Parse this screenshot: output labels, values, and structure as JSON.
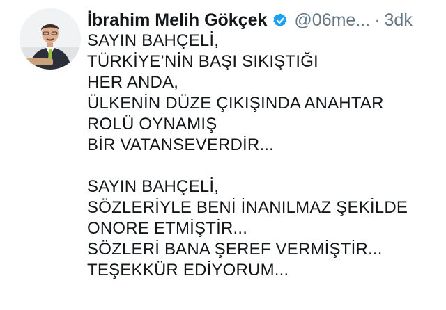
{
  "tweet": {
    "author_name": "İbrahim Melih Gökçek",
    "handle": "@06me...",
    "separator": "·",
    "time": "3dk",
    "paragraphs": [
      [
        "SAYIN BAHÇELİ,",
        "TÜRKİYE’NİN BAŞI SIKIŞTIĞI",
        "HER ANDA,",
        "ÜLKENİN DÜZE ÇIKIŞINDA ANAHTAR",
        "ROLÜ OYNAMIŞ",
        "BİR VATANSEVERDİR..."
      ],
      [
        "SAYIN BAHÇELİ,",
        "SÖZLERİYLE BENİ İNANILMAZ ŞEKİLDE",
        "ONORE ETMİŞTİR...",
        "SÖZLERİ BANA ŞEREF VERMİŞTİR...",
        "TEŞEKKÜR EDİYORUM..."
      ]
    ]
  },
  "icons": {
    "verified": "verified-badge-icon",
    "avatar": "profile-photo"
  },
  "colors": {
    "text": "#14171a",
    "muted": "#657786",
    "verified_blue": "#1da1f2"
  }
}
